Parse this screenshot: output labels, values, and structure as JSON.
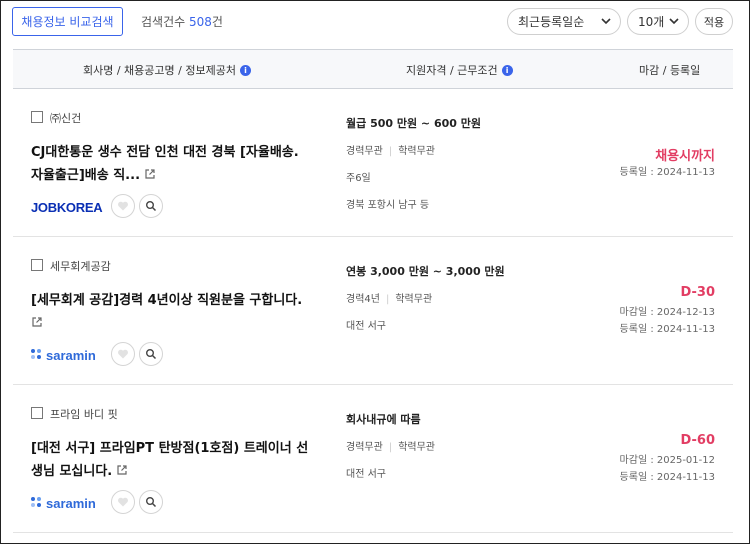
{
  "toolbar": {
    "compare_label": "채용정보 비교검색",
    "count_label": "검색건수",
    "count_value": "508",
    "count_unit": "건",
    "sort_selected": "최근등록일순",
    "per_page_selected": "10개",
    "apply_label": "적용"
  },
  "table_header": {
    "col1": "회사명 / 채용공고명 / 정보제공처",
    "col2": "지원자격 / 근무조건",
    "col3": "마감 / 등록일"
  },
  "jobs": [
    {
      "company": "㈜신건",
      "title_line1": "CJ대한통운 생수 전담 인천 대전 경북 [자율배송.",
      "title_line2": "자율출근]배송 직...",
      "source": "JOBKOREA",
      "salary": "월급 500 만원 ~ 600 만원",
      "experience": "경력무관",
      "education": "학력무관",
      "workdays": "주6일",
      "location": "경북 포항시 남구 등",
      "deadline": "채용시까지",
      "registered": "등록일 : 2024-11-13"
    },
    {
      "company": "세무회계공감",
      "title_line1": "[세무회계 공감]경력 4년이상 직원분을 구합니다.",
      "title_line2": "",
      "source": "saramin",
      "salary": "연봉 3,000 만원 ~ 3,000 만원",
      "experience": "경력4년",
      "education": "학력무관",
      "location": "대전 서구",
      "deadline": "D-30",
      "closing": "마감일 : 2024-12-13",
      "registered": "등록일 : 2024-11-13"
    },
    {
      "company": "프라임 바디 핏",
      "title_line1": "[대전 서구] 프라임PT 탄방점(1호점) 트레이너 선",
      "title_line2": "생님 모십니다.",
      "source": "saramin",
      "salary": "회사내규에 따름",
      "experience": "경력무관",
      "education": "학력무관",
      "location": "대전 서구",
      "deadline": "D-60",
      "closing": "마감일 : 2025-01-12",
      "registered": "등록일 : 2024-11-13"
    }
  ],
  "colors": {
    "accent": "#3a64ea",
    "deadline": "#e23d63",
    "jobkorea": "#0a2fb4",
    "saramin": "#2f6ad9"
  },
  "icons": [
    "chevron-down-icon",
    "info-icon",
    "external-link-icon",
    "heart-icon",
    "search-icon"
  ]
}
